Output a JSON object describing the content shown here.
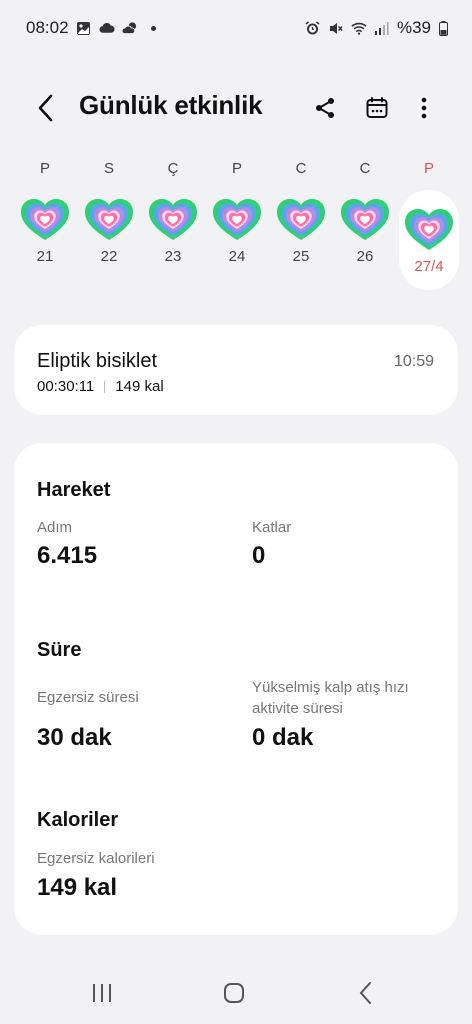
{
  "status_bar": {
    "time": "08:02",
    "battery": "%39",
    "icons_left": [
      "gallery-icon",
      "cloud-icon",
      "weather-icon",
      "dot-icon"
    ],
    "icons_right": [
      "alarm-icon",
      "mute-icon",
      "wifi-icon",
      "signal-icon",
      "battery-icon"
    ]
  },
  "header": {
    "title": "Günlük etkinlik",
    "actions": [
      "share-icon",
      "calendar-icon",
      "more-icon"
    ]
  },
  "week": {
    "days": [
      {
        "letter": "P",
        "num": "21"
      },
      {
        "letter": "S",
        "num": "22"
      },
      {
        "letter": "Ç",
        "num": "23"
      },
      {
        "letter": "P",
        "num": "24"
      },
      {
        "letter": "C",
        "num": "25"
      },
      {
        "letter": "C",
        "num": "26"
      },
      {
        "letter": "P",
        "num": "27/4"
      }
    ],
    "selected_index": 6,
    "colors": {
      "selected": "#e0534f",
      "ring_outer": "#2fcf76",
      "ring_mid": "#5aa7e8",
      "ring_inner": "#b58be6",
      "heart": "#ff6fa6"
    }
  },
  "activity": {
    "name": "Eliptik bisiklet",
    "time": "10:59",
    "duration": "00:30:11",
    "calories": "149 kal"
  },
  "stats": {
    "movement": {
      "title": "Hareket",
      "steps_label": "Adım",
      "steps_value": "6.415",
      "floors_label": "Katlar",
      "floors_value": "0"
    },
    "duration": {
      "title": "Süre",
      "exercise_label": "Egzersiz süresi",
      "exercise_value": "30 dak",
      "hr_label_line1": "Yükselmiş kalp atış hızı",
      "hr_label_line2": "aktivite süresi",
      "hr_value": "0 dak"
    },
    "calories": {
      "title": "Kaloriler",
      "exercise_cal_label": "Egzersiz kalorileri",
      "exercise_cal_value": "149 kal"
    }
  },
  "navbar": [
    "recents-icon",
    "home-icon",
    "back-nav-icon"
  ]
}
